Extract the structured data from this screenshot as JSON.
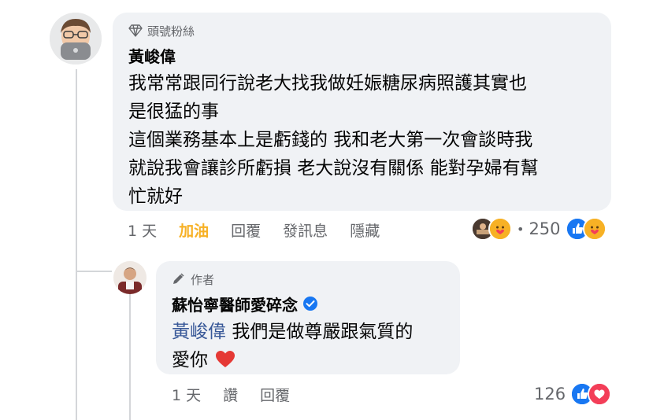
{
  "comment": {
    "badge_label": "頭號粉絲",
    "author": "黃峻偉",
    "text_lines": [
      "我常常跟同行說老大找我做妊娠糖尿病照護其實也",
      "是很猛的事",
      "這個業務基本上是虧錢的 我和老大第一次會談時我",
      "就說我會讓診所虧損 老大說沒有關係 能對孕婦有幫",
      "忙就好"
    ],
    "time": "1 天",
    "reaction_button": "加油",
    "reply": "回覆",
    "message": "發訊息",
    "hide": "隱藏",
    "reaction_count": "250",
    "reaction_icons": [
      "avatar-icon",
      "care-icon",
      "like-icon",
      "care-icon"
    ]
  },
  "reply": {
    "badge_label": "作者",
    "author": "蘇怡寧醫師愛碎念",
    "mention": "黃峻偉",
    "text_after_mention": "我們是做尊嚴跟氣質的",
    "line2": "愛你",
    "time": "1 天",
    "like": "讚",
    "reply": "回覆",
    "reaction_count": "126",
    "reaction_icons": [
      "like-icon",
      "love-icon"
    ]
  },
  "colors": {
    "bubble": "#f0f2f5",
    "secondary_text": "#65676b",
    "care_yellow": "#f7b125",
    "like_blue": "#1877f2",
    "mention_blue": "#385898",
    "love_red": "#f33e58"
  }
}
